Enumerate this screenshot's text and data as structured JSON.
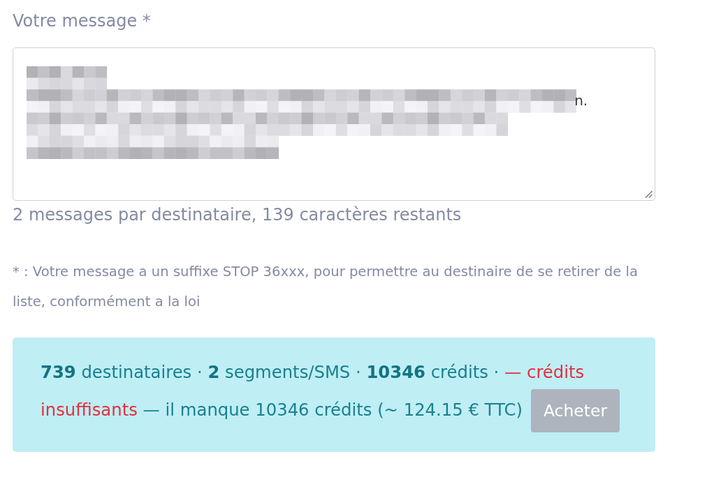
{
  "message_field": {
    "label": "Votre message *",
    "visible_fragment": "n."
  },
  "counter": "2 messages par destinataire, 139 caractères restants",
  "footnote": "* : Votre message a un suffixe STOP 36xxx, pour permettre au destinaire de se retirer de la liste, conformément a la loi",
  "credit_panel": {
    "summary": "**739** destinataires · **2** segments/SMS · **10346** crédits ·",
    "warning": "— crédits insuffisants",
    "shortfall": "— il manque 10346 crédits (~ 124.15 € TTC)",
    "buy_button": "Acheter"
  }
}
